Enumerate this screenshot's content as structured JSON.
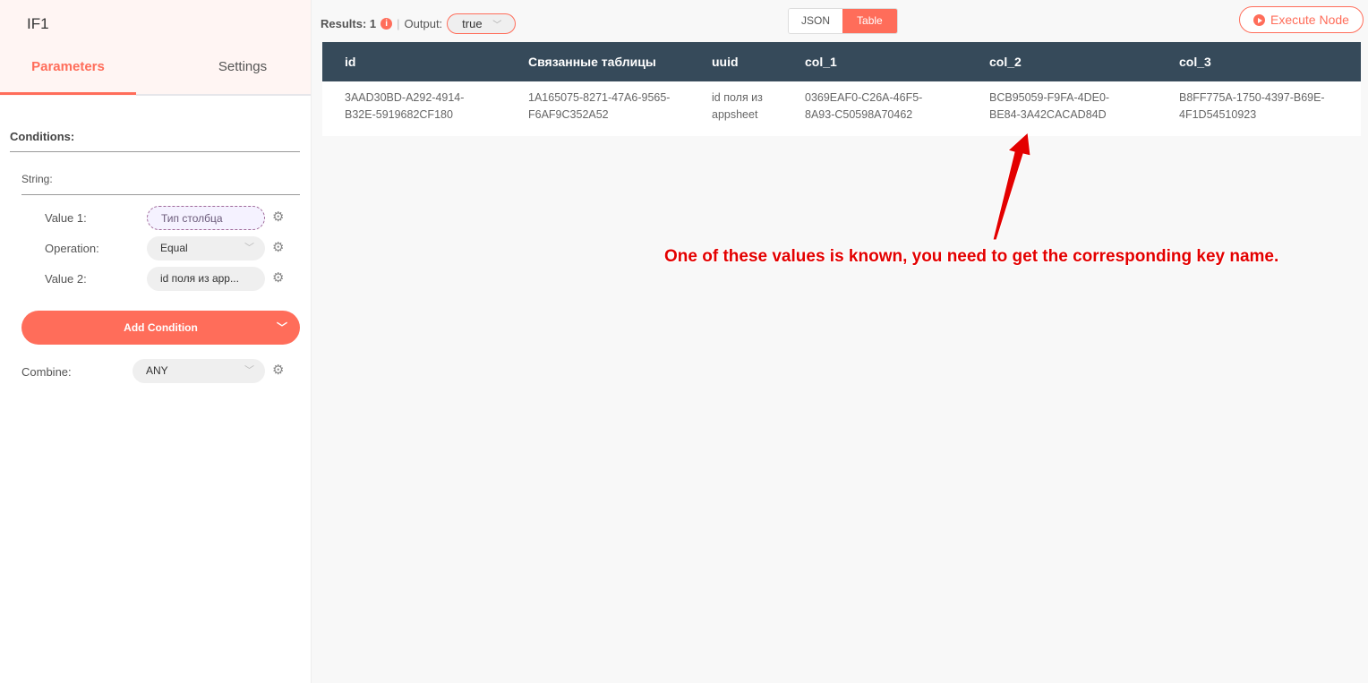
{
  "node": {
    "title": "IF1",
    "tabs": [
      "Parameters",
      "Settings"
    ]
  },
  "params": {
    "conditions_label": "Conditions:",
    "string_label": "String:",
    "rows": [
      {
        "label": "Value 1:",
        "value": "Тип столбца"
      },
      {
        "label": "Operation:",
        "value": "Equal"
      },
      {
        "label": "Value 2:",
        "value": "id поля из app..."
      }
    ],
    "add_condition": "Add Condition",
    "combine_label": "Combine:",
    "combine_value": "ANY"
  },
  "results": {
    "label": "Results: 1",
    "output_label": "Output:",
    "output_value": "true",
    "view_json": "JSON",
    "view_table": "Table",
    "execute": "Execute Node"
  },
  "table": {
    "headers": [
      "id",
      "Связанные таблицы",
      "uuid",
      "col_1",
      "col_2",
      "col_3"
    ],
    "rows": [
      [
        "3AAD30BD-A292-4914-B32E-5919682CF180",
        "1A165075-8271-47A6-9565-F6AF9C352A52",
        "id поля из appsheet",
        "0369EAF0-C26A-46F5-8A93-C50598A70462",
        "BCB95059-F9FA-4DE0-BE84-3A42CACAD84D",
        "B8FF775A-1750-4397-B69E-4F1D54510923"
      ]
    ]
  },
  "annotation": "One of these values is known, you need to get the corresponding key name."
}
